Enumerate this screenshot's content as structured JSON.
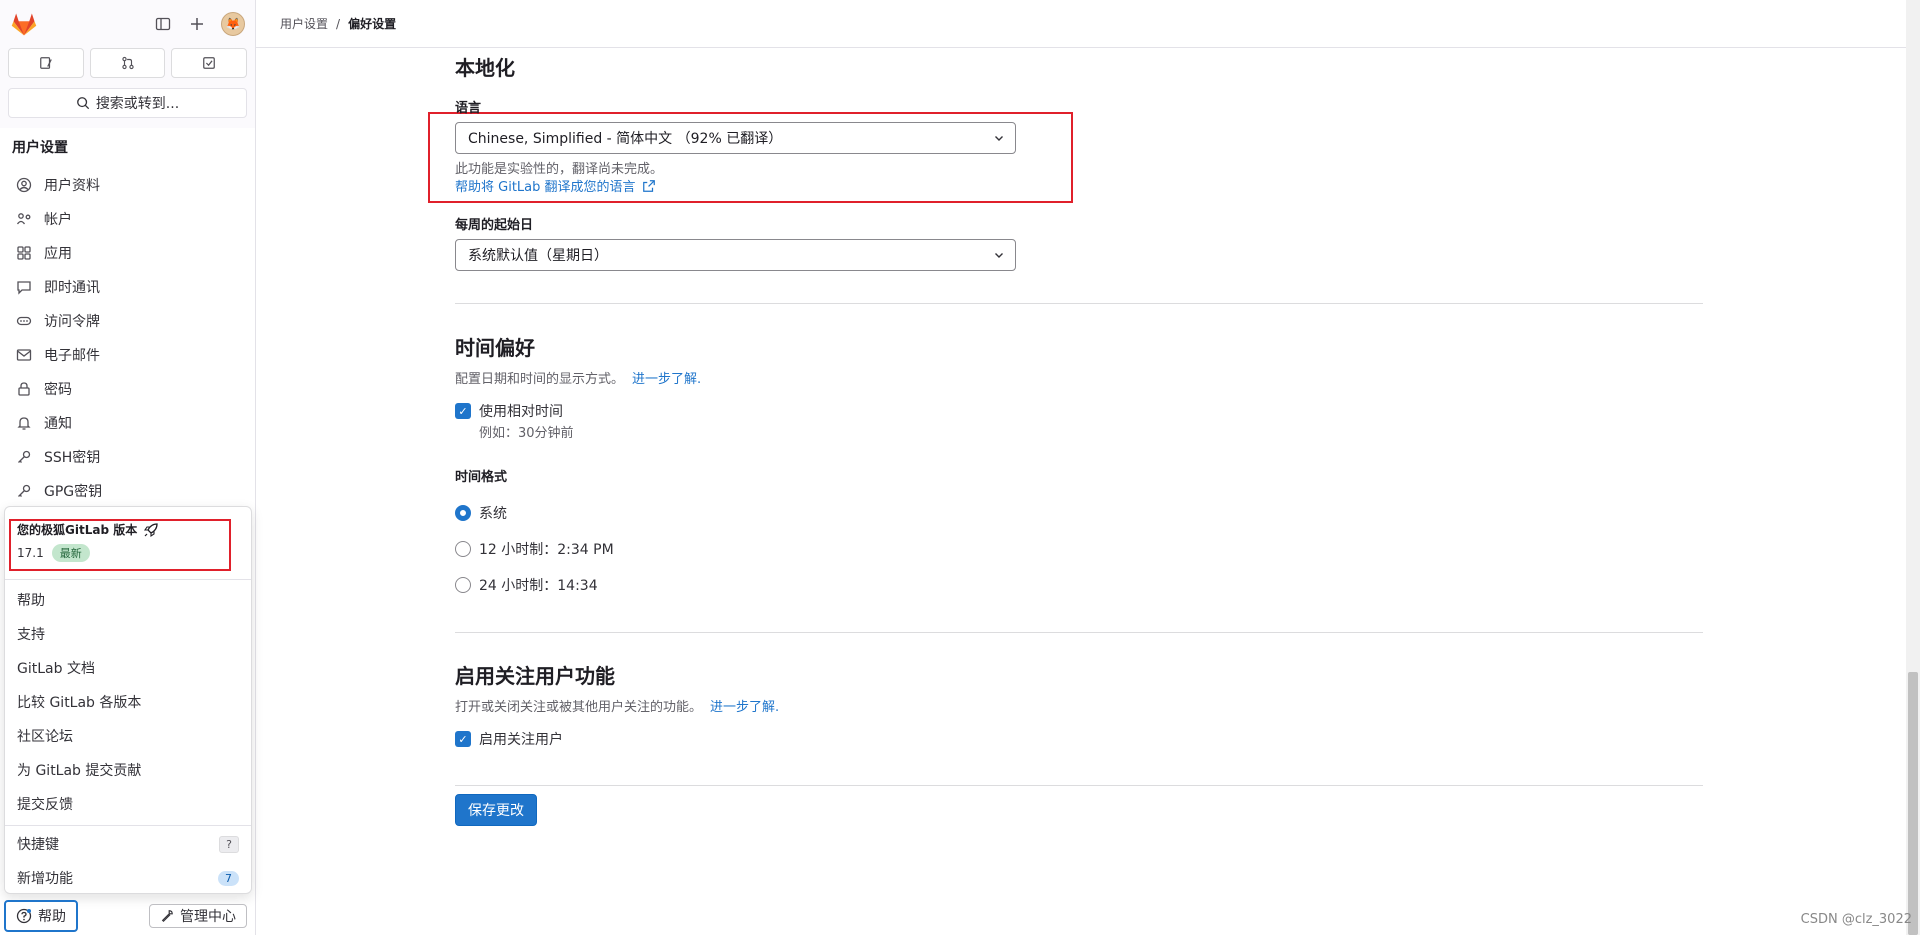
{
  "sidebar": {
    "search_label": "搜索或转到...",
    "section_title": "用户设置",
    "items": [
      {
        "label": "用户资料",
        "icon": "user-icon"
      },
      {
        "label": "帐户",
        "icon": "account-icon"
      },
      {
        "label": "应用",
        "icon": "apps-icon"
      },
      {
        "label": "即时通讯",
        "icon": "chat-icon"
      },
      {
        "label": "访问令牌",
        "icon": "token-icon"
      },
      {
        "label": "电子邮件",
        "icon": "mail-icon"
      },
      {
        "label": "密码",
        "icon": "lock-icon"
      },
      {
        "label": "通知",
        "icon": "bell-icon"
      },
      {
        "label": "SSH密钥",
        "icon": "key-icon"
      },
      {
        "label": "GPG密钥",
        "icon": "key-icon"
      }
    ],
    "help_label": "帮助",
    "admin_label": "管理中心"
  },
  "help_popover": {
    "version_title": "您的极狐GitLab 版本",
    "version": "17.1",
    "latest_badge": "最新",
    "items": [
      "帮助",
      "支持",
      "GitLab 文档",
      "比较 GitLab 各版本",
      "社区论坛",
      "为 GitLab 提交贡献",
      "提交反馈"
    ],
    "shortcuts_label": "快捷键",
    "shortcuts_key": "?",
    "whats_new_label": "新增功能",
    "whats_new_count": "7"
  },
  "breadcrumb": {
    "parent": "用户设置",
    "separator": "/",
    "current": "偏好设置"
  },
  "localization": {
    "title": "本地化",
    "language_label": "语言",
    "language_value": "Chinese, Simplified - 简体中文 （92% 已翻译）",
    "language_help": "此功能是实验性的，翻译尚未完成。",
    "translate_link": "帮助将 GitLab 翻译成您的语言",
    "week_start_label": "每周的起始日",
    "week_start_value": "系统默认值（星期日）"
  },
  "time_prefs": {
    "title": "时间偏好",
    "description": "配置日期和时间的显示方式。",
    "learn_more": "进一步了解.",
    "relative_time_label": "使用相对时间",
    "relative_time_example": "例如：30分钟前",
    "format_label": "时间格式",
    "options": [
      "系统",
      "12 小时制：2:34 PM",
      "24 小时制：14:34"
    ],
    "selected_index": 0
  },
  "follow": {
    "title": "启用关注用户功能",
    "description": "打开或关闭关注或被其他用户关注的功能。",
    "learn_more": "进一步了解.",
    "checkbox_label": "启用关注用户"
  },
  "save_label": "保存更改",
  "watermark": "CSDN @clz_3022",
  "colors": {
    "accent": "#1f75cb",
    "highlight_box": "#e0202b"
  }
}
